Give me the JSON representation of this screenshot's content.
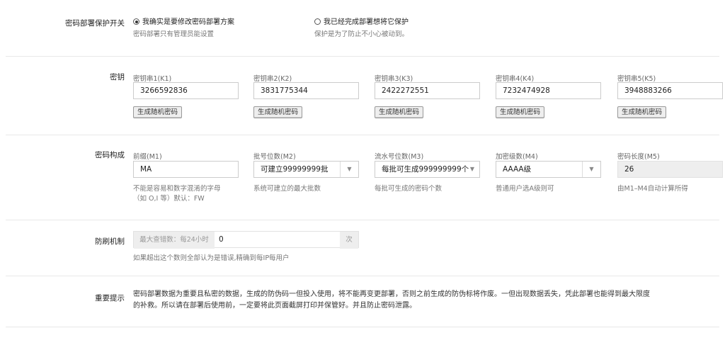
{
  "protect": {
    "label": "密码部署保护开关",
    "option1": {
      "label": "我确实是要修改密码部署方案",
      "hint": "密码部署只有管理员能设置",
      "selected": true
    },
    "option2": {
      "label": "我已经完成部署想将它保护",
      "hint": "保护是为了防止不小心被动到。",
      "selected": false
    }
  },
  "keys": {
    "label": "密钥",
    "button_label": "生成随机密码",
    "items": [
      {
        "label": "密钥串1(K1)",
        "value": "3266592836"
      },
      {
        "label": "密钥串2(K2)",
        "value": "3831775344"
      },
      {
        "label": "密钥串3(K3)",
        "value": "2422272551"
      },
      {
        "label": "密钥串4(K4)",
        "value": "7232474928"
      },
      {
        "label": "密钥串5(K5)",
        "value": "3948883266"
      }
    ]
  },
  "composition": {
    "label": "密码构成",
    "m1": {
      "label": "前缀(M1)",
      "value": "MA",
      "hint1": "不能是容易和数字混淆的字母",
      "hint2": "（如 O,I 等）默认：FW"
    },
    "m2": {
      "label": "批号位数(M2)",
      "value": "可建立99999999批",
      "hint": "系统可建立的最大批数"
    },
    "m3": {
      "label": "流水号位数(M3)",
      "value": "每批可生成999999999个",
      "hint": "每批可生成的密码个数"
    },
    "m4": {
      "label": "加密级数(M4)",
      "value": "AAAA级",
      "hint": "普通用户选A级则可"
    },
    "m5": {
      "label": "密码长度(M5)",
      "value": "26",
      "hint": "由M1–M4自动计算所得"
    }
  },
  "antibrush": {
    "label": "防刷机制",
    "prefix": "最大查错数：每24小时",
    "value": "0",
    "suffix": "次",
    "hint": "如果超出这个数则全部认为是错误,精确到每IP每用户"
  },
  "notice": {
    "label": "重要提示",
    "line1": "密码部署数据为重要且私密的数据，生成的防伪码一但投入使用，将不能再变更部署，否则之前生成的防伪标将作废。一但出现数据丢失，凭此部署也能得到最大限度",
    "line2": "的补救。所以请在部署后使用前，一定要将此页面截屏打印并保管好。并且防止密码泄露。"
  },
  "icons": {
    "caret": "▼"
  }
}
